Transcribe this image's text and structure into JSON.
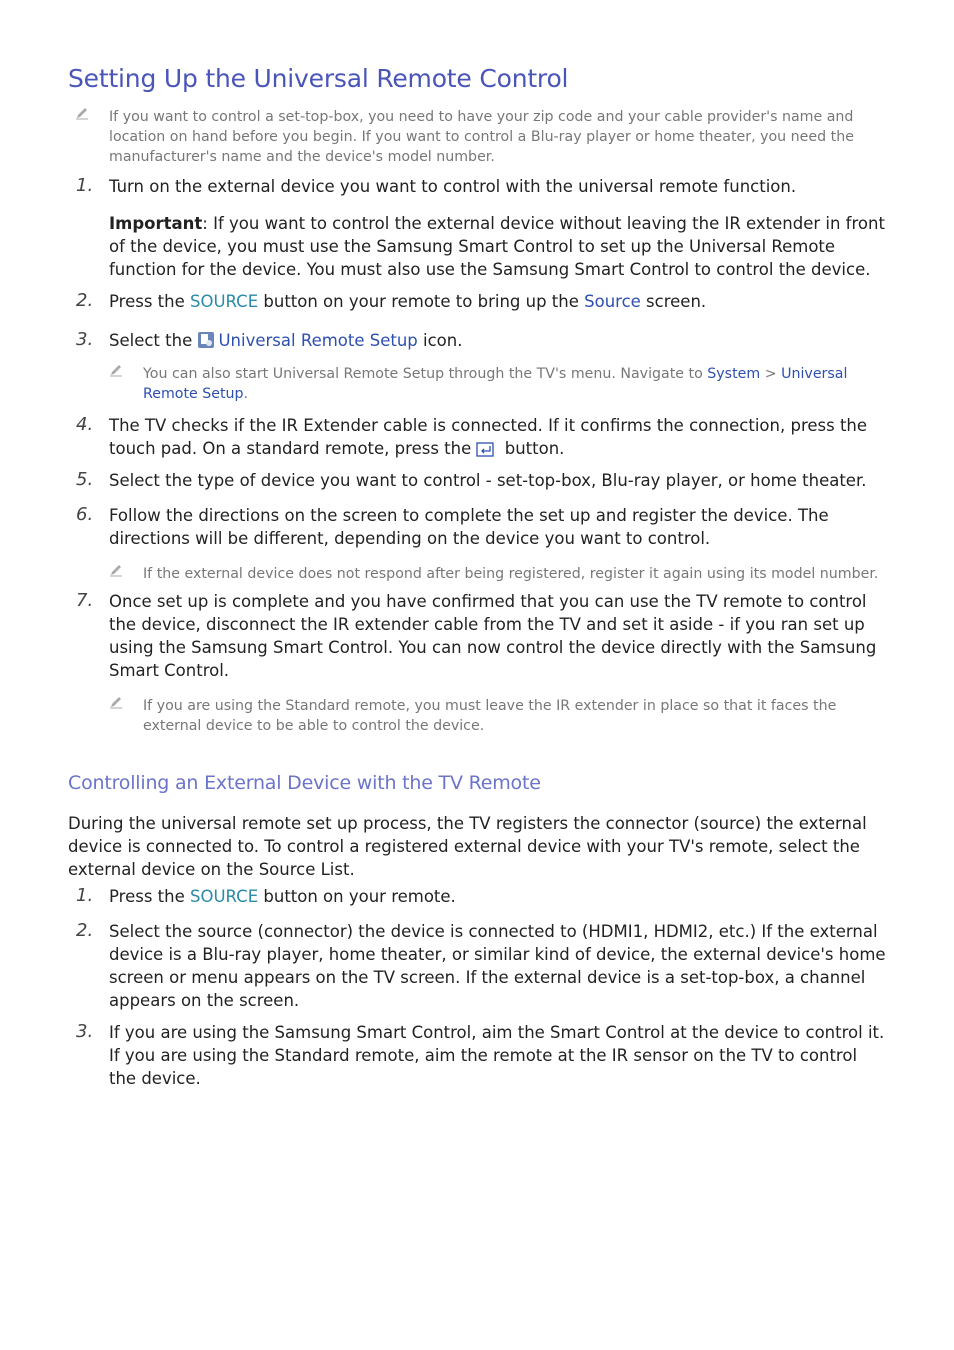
{
  "title": "Setting Up the Universal Remote Control",
  "intro_note": "If you want to control a set-top-box, you need to have your zip code and your cable provider's name and location on hand before you begin. If you want to control a Blu-ray player or home theater, you need the manufacturer's name and the device's model number.",
  "steps": {
    "s1": {
      "num": "1.",
      "text": "Turn on the external device you want to control with the universal remote function."
    },
    "important": {
      "label": "Important",
      "text": ": If you want to control the external device without leaving the IR extender in front of the device, you must use the Samsung Smart Control to set up the Universal Remote function for the device. You must also use the Samsung Smart Control to control the device."
    },
    "s2": {
      "num": "2.",
      "a": "Press the ",
      "source": "SOURCE",
      "b": " button on your remote to bring up the ",
      "screen": "Source",
      "c": " screen."
    },
    "s3": {
      "num": "3.",
      "a": "Select the ",
      "link": "Universal Remote Setup",
      "b": " icon."
    },
    "s3_note": {
      "a": "You can also start Universal Remote Setup through the TV's menu. Navigate to ",
      "system": "System",
      "sep": " > ",
      "setup": "Universal Remote Setup",
      "end": "."
    },
    "s4": {
      "num": "4.",
      "a": "The TV checks if the IR Extender cable is connected. If it confirms the connection, press the touch pad. On a standard remote, press the ",
      "b": " button."
    },
    "s5": {
      "num": "5.",
      "text": "Select the type of device you want to control - set-top-box, Blu-ray player, or home theater."
    },
    "s6": {
      "num": "6.",
      "text": "Follow the directions on the screen to complete the set up and register the device. The directions will be different, depending on the device you want to control."
    },
    "s6_note": "If the external device does not respond after being registered, register it again using its model number.",
    "s7": {
      "num": "7.",
      "text": "Once set up is complete and you have confirmed that you can use the TV remote to control the device, disconnect the IR extender cable from the TV and set it aside - if you ran set up using the Samsung Smart Control. You can now control the device directly with the Samsung Smart Control."
    },
    "s7_note": "If you are using the Standard remote, you must leave the IR extender in place so that it faces the external device to be able to control the device."
  },
  "section2": {
    "title": "Controlling an External Device with the TV Remote",
    "body": "During the universal remote set up process, the TV registers the connector (source) the external device is connected to. To control a registered external device with your TV's remote, select the external device on the Source List.",
    "s1": {
      "num": "1.",
      "a": "Press the ",
      "source": "SOURCE",
      "b": " button on your remote."
    },
    "s2": {
      "num": "2.",
      "text": "Select the source (connector) the device is connected to (HDMI1, HDMI2, etc.) If the external device is a Blu-ray player, home theater, or similar kind of device, the external device's home screen or menu appears on the TV screen. If the external device is a set-top-box, a channel appears on the screen."
    },
    "s3": {
      "num": "3.",
      "text": "If you are using the Samsung Smart Control, aim the Smart Control at the device to control it.",
      "text2": "If you are using the Standard remote, aim the remote at the IR sensor on the TV to control the device."
    }
  }
}
